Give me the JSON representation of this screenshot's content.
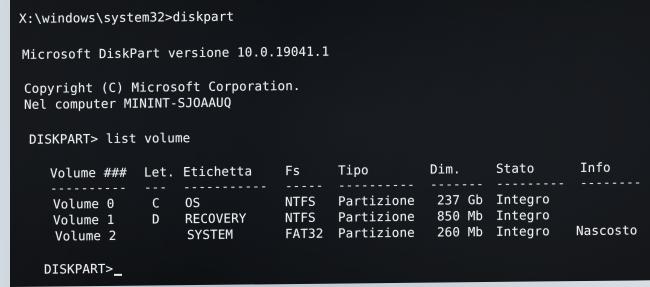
{
  "console": {
    "prompt_line": "X:\\windows\\system32>diskpart",
    "version_line": "Microsoft DiskPart versione 10.0.19041.1",
    "copyright_line": "Copyright (C) Microsoft Corporation.",
    "computer_line": "Nel computer MININT-SJOAAUQ",
    "command_line": "DISKPART> list volume",
    "final_prompt": "DISKPART>"
  },
  "table": {
    "headers": {
      "volume": "Volume ###",
      "letter": "Let.",
      "label": "Etichetta",
      "fs": "Fs",
      "type": "Tipo",
      "size": "Dim.",
      "status": "Stato",
      "info": "Info"
    },
    "separators": {
      "volume": "----------",
      "letter": "---",
      "label": "-----------",
      "fs": "-----",
      "type": "----------",
      "size": "-------",
      "status": "---------",
      "info": "--------"
    },
    "rows": [
      {
        "volume": "Volume 0",
        "letter": "C",
        "label": "OS",
        "fs": "NTFS",
        "type": "Partizione",
        "size": "237 Gb",
        "status": "Integro",
        "info": ""
      },
      {
        "volume": "Volume 1",
        "letter": "D",
        "label": "RECOVERY",
        "fs": "NTFS",
        "type": "Partizione",
        "size": "850 Mb",
        "status": "Integro",
        "info": ""
      },
      {
        "volume": "Volume 2",
        "letter": "",
        "label": "SYSTEM",
        "fs": "FAT32",
        "type": "Partizione",
        "size": "260 Mb",
        "status": "Integro",
        "info": "Nascosto"
      }
    ]
  }
}
